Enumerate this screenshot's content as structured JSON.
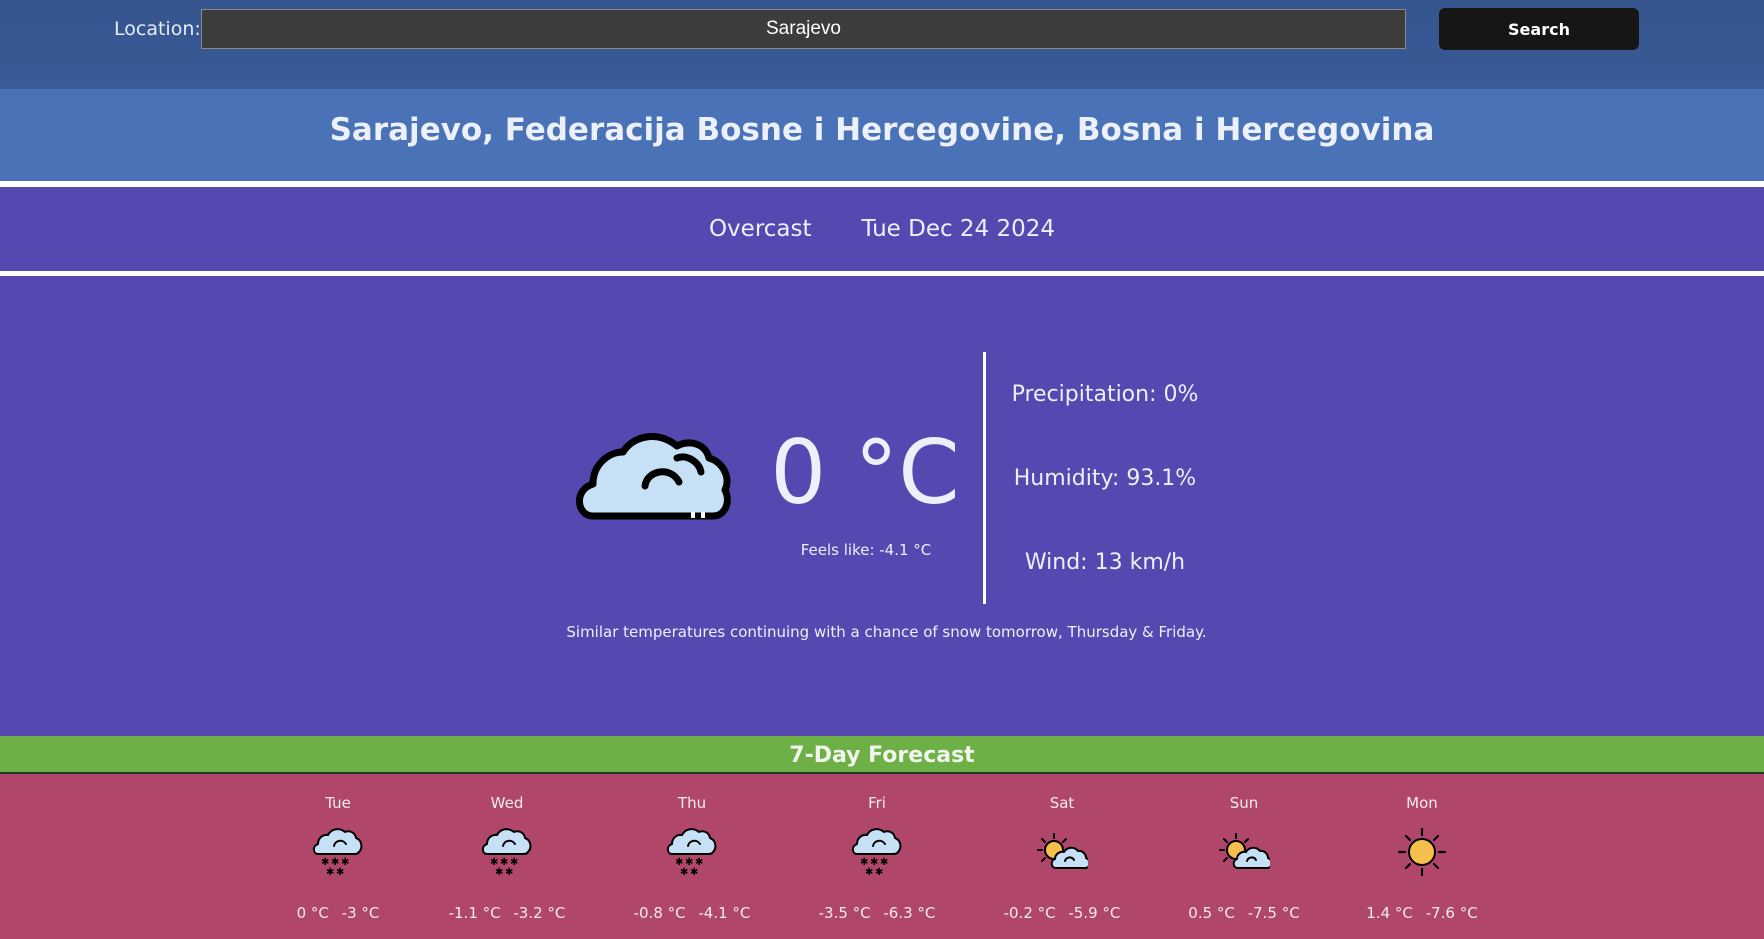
{
  "search": {
    "label": "Location:",
    "value": "Sarajevo",
    "button_label": "Search"
  },
  "location": {
    "full_name": "Sarajevo, Federacija Bosne i Hercegovine, Bosna i Hercegovina"
  },
  "current": {
    "condition": "Overcast",
    "date": "Tue Dec 24 2024",
    "icon": "cloud-icon",
    "temperature": "0 °C",
    "feels_like": "Feels like: -4.1 °C",
    "precipitation": "Precipitation: 0%",
    "humidity": "Humidity: 93.1%",
    "wind": "Wind: 13 km/h",
    "summary": "Similar temperatures continuing with a chance of snow tomorrow, Thursday & Friday."
  },
  "forecast": {
    "title": "7-Day Forecast",
    "days": [
      {
        "day": "Tue",
        "icon": "snow-cloud-icon",
        "high": "0 °C",
        "low": "-3 °C"
      },
      {
        "day": "Wed",
        "icon": "snow-cloud-icon",
        "high": "-1.1 °C",
        "low": "-3.2 °C"
      },
      {
        "day": "Thu",
        "icon": "snow-cloud-icon",
        "high": "-0.8 °C",
        "low": "-4.1 °C"
      },
      {
        "day": "Fri",
        "icon": "snow-cloud-icon",
        "high": "-3.5 °C",
        "low": "-6.3 °C"
      },
      {
        "day": "Sat",
        "icon": "partly-cloudy-icon",
        "high": "-0.2 °C",
        "low": "-5.9 °C"
      },
      {
        "day": "Sun",
        "icon": "partly-cloudy-icon",
        "high": "0.5 °C",
        "low": "-7.5 °C"
      },
      {
        "day": "Mon",
        "icon": "sun-icon",
        "high": "1.4 °C",
        "low": "-7.6 °C"
      }
    ]
  },
  "colors": {
    "top_bar": "#3a5a98",
    "location_band": "#4a72b6",
    "main_background": "#5548b0",
    "forecast_header": "#6cb046",
    "forecast_background": "#b0476b",
    "cloud_fill": "#c6e0f5",
    "sun_fill": "#f6bf4b"
  }
}
